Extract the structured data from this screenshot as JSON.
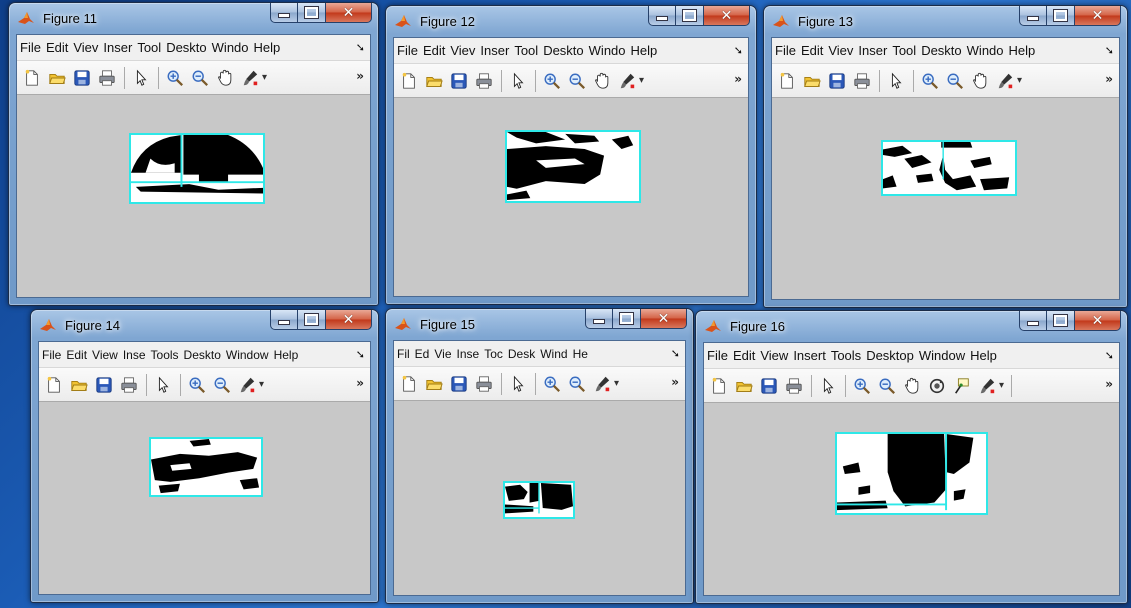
{
  "figures": [
    {
      "title": "Figure 11",
      "menus": [
        "File",
        "Edit",
        "Viev",
        "Inser",
        "Tool",
        "Deskto",
        "Windo",
        "Help"
      ]
    },
    {
      "title": "Figure 12",
      "menus": [
        "File",
        "Edit",
        "Viev",
        "Inser",
        "Tool",
        "Deskto",
        "Windo",
        "Help"
      ]
    },
    {
      "title": "Figure 13",
      "menus": [
        "File",
        "Edit",
        "Viev",
        "Inser",
        "Tool",
        "Deskto",
        "Windo",
        "Help"
      ]
    },
    {
      "title": "Figure 14",
      "menus": [
        "File",
        "Edit",
        "View",
        "Inse",
        "Tools",
        "Deskto",
        "Window",
        "Help"
      ]
    },
    {
      "title": "Figure 15",
      "menus": [
        "Fil",
        "Ed",
        "Vie",
        "Inse",
        "Toc",
        "Desk",
        "Wind",
        "He"
      ]
    },
    {
      "title": "Figure 16",
      "menus": [
        "File",
        "Edit",
        "View",
        "Insert",
        "Tools",
        "Desktop",
        "Window",
        "Help"
      ]
    }
  ],
  "toolbar_icons": [
    "new-figure",
    "open-file",
    "save",
    "print",
    "edit-plot-arrow",
    "zoom-in",
    "zoom-out",
    "pan-hand",
    "rotate-3d",
    "data-cursor",
    "brush"
  ],
  "colors": {
    "title_glass": "#7fa6d2",
    "canvas": "#c8c8c8",
    "plot_border": "#2ee8e8",
    "close_button": "#c2391b"
  }
}
